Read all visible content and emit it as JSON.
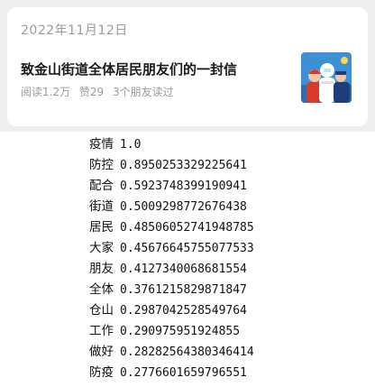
{
  "card": {
    "date": "2022年11月12日",
    "title": "致金山街道全体居民朋友们的一封信",
    "reads": "阅读1.2万",
    "likes": "赞29",
    "friends": "3个朋友读过"
  },
  "keywords": [
    {
      "word": "疫情",
      "score": "1.0"
    },
    {
      "word": "防控",
      "score": "0.8950253329225641"
    },
    {
      "word": "配合",
      "score": "0.5923748399190941"
    },
    {
      "word": "街道",
      "score": "0.5009298772676438"
    },
    {
      "word": "居民",
      "score": "0.48506052741948785"
    },
    {
      "word": "大家",
      "score": "0.45676645755077533"
    },
    {
      "word": "朋友",
      "score": "0.4127340068681554"
    },
    {
      "word": "全体",
      "score": "0.3761215829871847"
    },
    {
      "word": "仓山",
      "score": "0.2987042528549764"
    },
    {
      "word": "工作",
      "score": "0.290975951924855"
    },
    {
      "word": "做好",
      "score": "0.28282564380346414"
    },
    {
      "word": "防疫",
      "score": "0.2776601659796551"
    }
  ]
}
